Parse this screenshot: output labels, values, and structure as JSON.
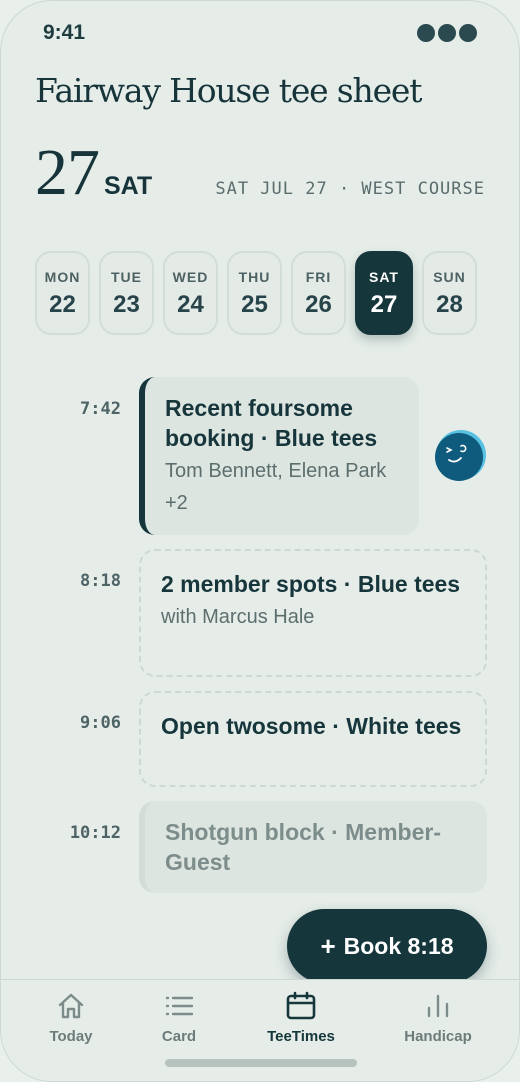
{
  "status": {
    "time": "9:41"
  },
  "header": {
    "title": "Fairway House tee sheet",
    "day_number": "27",
    "day_of_week": "SAT",
    "subline": "SAT JUL 27 · WEST COURSE"
  },
  "days": [
    {
      "name": "MON",
      "num": "22",
      "active": false
    },
    {
      "name": "TUE",
      "num": "23",
      "active": false
    },
    {
      "name": "WED",
      "num": "24",
      "active": false
    },
    {
      "name": "THU",
      "num": "25",
      "active": false
    },
    {
      "name": "FRI",
      "num": "26",
      "active": false
    },
    {
      "name": "SAT",
      "num": "27",
      "active": true
    },
    {
      "name": "SUN",
      "num": "28",
      "active": false
    }
  ],
  "slots": [
    {
      "time": "7:42",
      "title": "Recent foursome booking · Blue tees",
      "sub": "Tom Bennett, Elena Park +2",
      "avatar_icon": "golfer-avatar-icon"
    },
    {
      "time": "8:18",
      "title": "2 member spots · Blue tees",
      "sub": "with Marcus Hale"
    },
    {
      "time": "9:06",
      "title": "Open twosome · White tees"
    },
    {
      "time": "10:12",
      "title": "Shotgun block · Member-Guest"
    }
  ],
  "fab": {
    "icon": "plus",
    "label": "Book 8:18"
  },
  "nav": [
    {
      "label": "Today",
      "icon": "home-icon",
      "active": false
    },
    {
      "label": "Card",
      "icon": "list-icon",
      "active": false
    },
    {
      "label": "TeeTimes",
      "icon": "calendar-icon",
      "active": true
    },
    {
      "label": "Handicap",
      "icon": "bar-chart-icon",
      "active": false
    }
  ],
  "colors": {
    "accent": "#15363b",
    "background": "#e6ede9",
    "avatar": "#0f5b7d"
  }
}
